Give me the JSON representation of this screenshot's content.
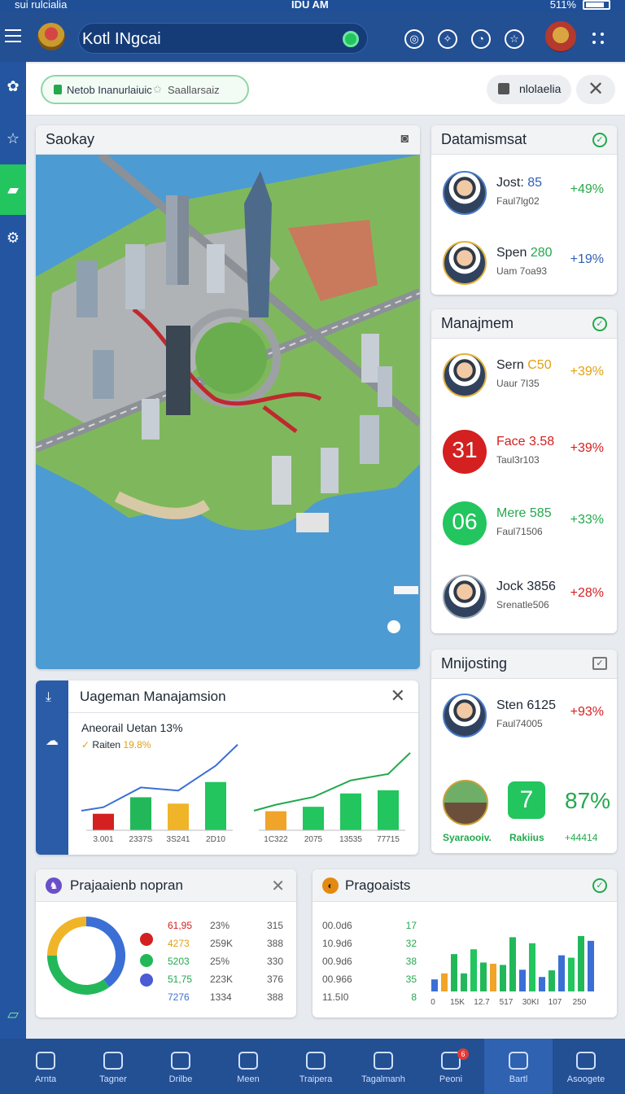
{
  "status": {
    "left": "sui rulcialia",
    "time": "IDU AM",
    "right": "511%"
  },
  "appbar": {
    "search_value": "Kotl INgcai"
  },
  "filter": {
    "chip_a": "Netob Inanurlaiuic",
    "chip_b": "Saallarsaiz",
    "pill": "nlolaelia"
  },
  "map_panel": {
    "title": "Saokay"
  },
  "datamismsat": {
    "title": "Datamismsat",
    "rows": [
      {
        "name": "Jost:",
        "value": "85",
        "sub": "Faul7lg02",
        "pct": "+49%"
      },
      {
        "name": "Spen",
        "value": "280",
        "sub": "Uam 7oa93",
        "pct": "+19%"
      }
    ]
  },
  "manajmem": {
    "title": "Manajmem",
    "rows": [
      {
        "avatar": "",
        "name": "Sern",
        "value": "C50",
        "sub": "Uaur 7I35",
        "pct": "+39%"
      },
      {
        "avatar": "31",
        "name": "Face",
        "value": "3.58",
        "sub": "Taul3r103",
        "pct": "+39%"
      },
      {
        "avatar": "06",
        "name": "Mere",
        "value": "585",
        "sub": "Faul71506",
        "pct": "+33%"
      },
      {
        "avatar": "",
        "name": "Jock",
        "value": "3856",
        "sub": "Srenatle506",
        "pct": "+28%"
      }
    ]
  },
  "usage": {
    "title": "Uageman Manajamsion",
    "line1": "Aneorail Uetan 13%",
    "line2_label": "Raiten",
    "line2_value": "19.8%",
    "chart_a_ticks": [
      "3.001",
      "2337S",
      "3S241",
      "2D10"
    ],
    "chart_b_ticks": [
      "1C322",
      "2075",
      "13535",
      "77715"
    ]
  },
  "mnijosting": {
    "title": "Mnijosting",
    "row": {
      "name": "Sten",
      "value": "6125",
      "sub": "Faul74005",
      "pct": "+93%"
    },
    "card1_label": "Syaraooiv.",
    "card2_num": "7",
    "card2_label": "Rakiius",
    "card3_num": "87%",
    "card3_label": "+44414"
  },
  "prajaaien": {
    "title": "Prajaaienb nopran",
    "rows": [
      {
        "a": "61,95",
        "b": "23%",
        "c": "315"
      },
      {
        "a": "4273",
        "b": "259K",
        "c": "388"
      },
      {
        "a": "5203",
        "b": "25%",
        "c": "330"
      },
      {
        "a": "51,75",
        "b": "223K",
        "c": "376"
      },
      {
        "a": "7276",
        "b": "1334",
        "c": "388"
      }
    ]
  },
  "pragoaists": {
    "title": "Pragoaists",
    "rows": [
      {
        "a": "00.0d6",
        "b": "17"
      },
      {
        "a": "10.9d6",
        "b": "32"
      },
      {
        "a": "00.9d6",
        "b": "38"
      },
      {
        "a": "00.966",
        "b": "35"
      },
      {
        "a": "11.5I0",
        "b": "8"
      }
    ],
    "ticks": [
      "0",
      "15K",
      "12.7",
      "517",
      "30KI",
      "107",
      "250"
    ]
  },
  "nav": [
    {
      "label": "Arnta"
    },
    {
      "label": "Tagner"
    },
    {
      "label": "Drilbe"
    },
    {
      "label": "Meen"
    },
    {
      "label": "Traipera"
    },
    {
      "label": "Tagalmanh"
    },
    {
      "label": "Peoni"
    },
    {
      "label": "Bartl"
    },
    {
      "label": "Asoogete"
    }
  ],
  "chart_data": [
    {
      "type": "bar",
      "categories": [
        "3.001",
        "2337S",
        "3S241",
        "2D10"
      ],
      "values": [
        26,
        52,
        42,
        76
      ],
      "ylim": [
        0,
        100
      ]
    },
    {
      "type": "bar",
      "categories": [
        "1C322",
        "2075",
        "13535",
        "77715"
      ],
      "values": [
        30,
        37,
        58,
        63
      ],
      "ylim": [
        0,
        100
      ]
    },
    {
      "type": "pie",
      "values": [
        40,
        35,
        25
      ],
      "colors": [
        "#3b6fd6",
        "#22b85a",
        "#f0b429"
      ]
    },
    {
      "type": "bar",
      "categories": [
        "0",
        "15K",
        "12.7",
        "517",
        "30KI",
        "107",
        "250"
      ],
      "values": [
        20,
        30,
        62,
        30,
        70,
        48,
        46,
        44,
        90,
        36,
        80,
        24,
        35,
        60,
        56,
        92,
        84
      ]
    }
  ],
  "colors": {
    "brand": "#234f93",
    "accent": "#22c55e",
    "danger": "#d42020",
    "warning": "#e39f10"
  }
}
